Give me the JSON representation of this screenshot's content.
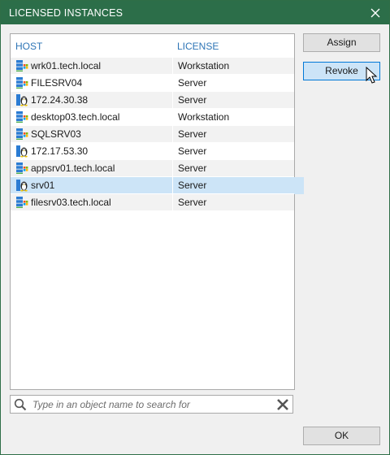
{
  "window": {
    "title": "LICENSED INSTANCES"
  },
  "columns": {
    "host": "HOST",
    "license": "LICENSE"
  },
  "rows": [
    {
      "host": "wrk01.tech.local",
      "license": "Workstation",
      "icon": "windows-server-icon"
    },
    {
      "host": "FILESRV04",
      "license": "Server",
      "icon": "windows-server-icon"
    },
    {
      "host": "172.24.30.38",
      "license": "Server",
      "icon": "linux-server-icon"
    },
    {
      "host": "desktop03.tech.local",
      "license": "Workstation",
      "icon": "windows-server-icon"
    },
    {
      "host": "SQLSRV03",
      "license": "Server",
      "icon": "windows-server-icon"
    },
    {
      "host": "172.17.53.30",
      "license": "Server",
      "icon": "linux-server-icon"
    },
    {
      "host": "appsrv01.tech.local",
      "license": "Server",
      "icon": "windows-server-icon"
    },
    {
      "host": "srv01",
      "license": "Server",
      "icon": "linux-server-icon",
      "selected": true
    },
    {
      "host": "filesrv03.tech.local",
      "license": "Server",
      "icon": "windows-server-icon"
    }
  ],
  "buttons": {
    "assign": "Assign",
    "revoke": "Revoke",
    "ok": "OK"
  },
  "search": {
    "placeholder": "Type in an object name to search for",
    "value": ""
  },
  "colors": {
    "titlebar": "#2c6e49",
    "header_text": "#2e75b6",
    "selection": "#cce4f7",
    "windows_icon_blue": "#2b7cd3",
    "windows_icon_green": "#4caf50",
    "linux_icon_yellow": "#f0c400"
  }
}
